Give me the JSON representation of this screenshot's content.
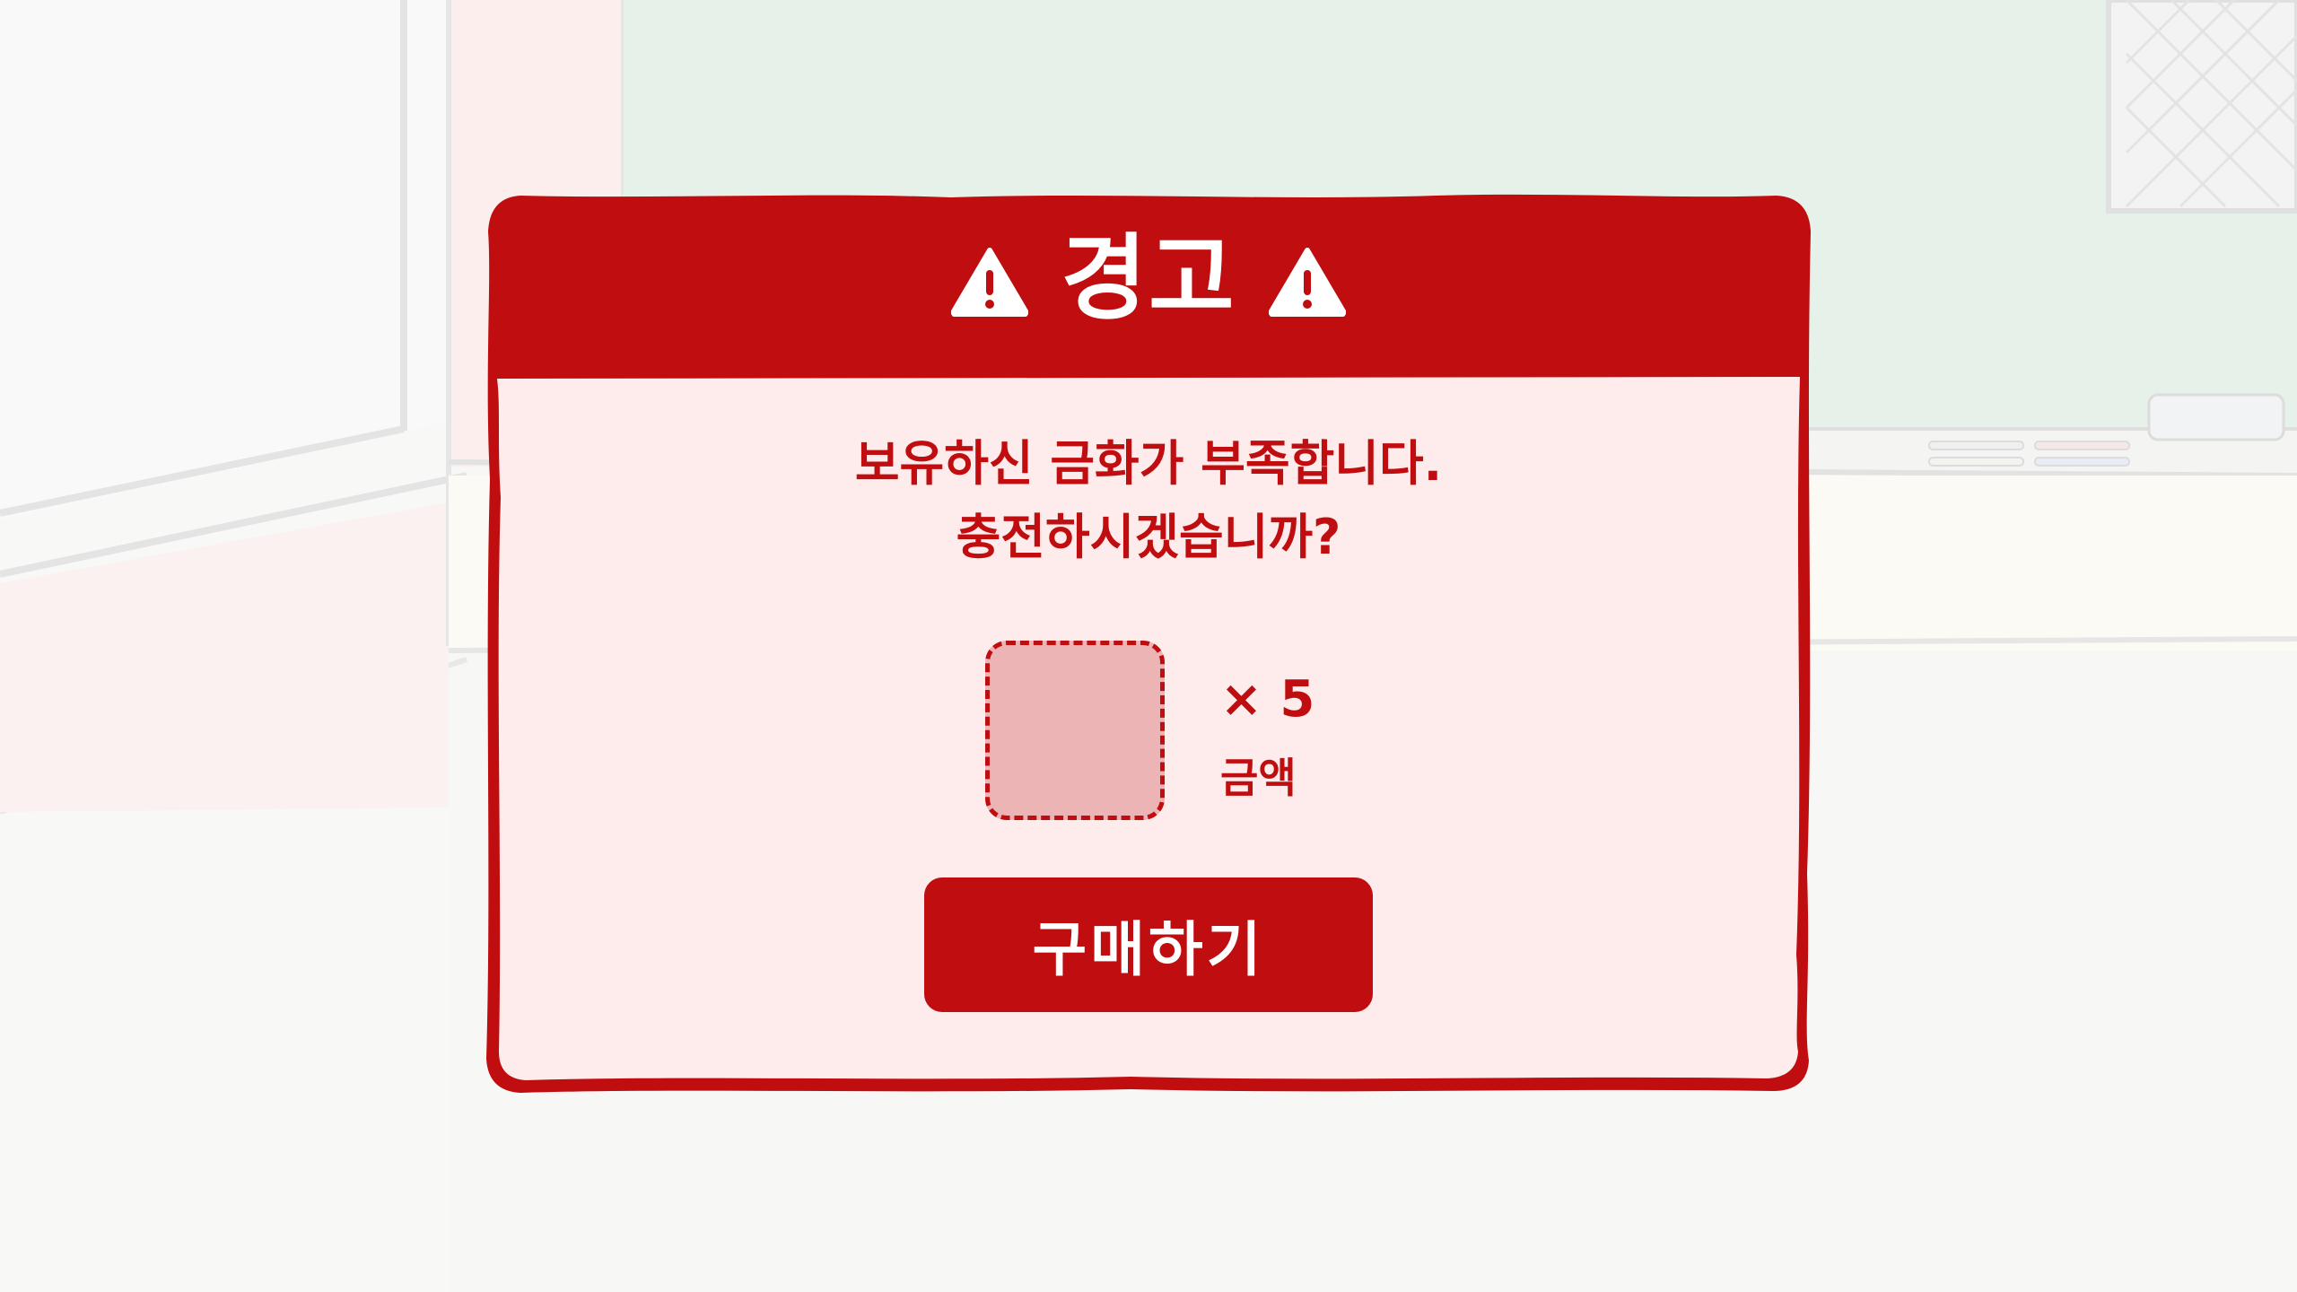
{
  "dialog": {
    "title": "경고",
    "title_icon": "warning-icon",
    "message_line1": "보유하신 금화가 부족합니다.",
    "message_line2": "충전하시겠습니까?",
    "cost": {
      "item_icon": "coin-placeholder",
      "quantity": "× 5",
      "label": "금액"
    },
    "buy_label": "구매하기"
  },
  "colors": {
    "accent": "#c00d0f",
    "panel": "#fdeceb",
    "slot_fill": "#ecb4b4",
    "background": "#f7f7f5"
  }
}
